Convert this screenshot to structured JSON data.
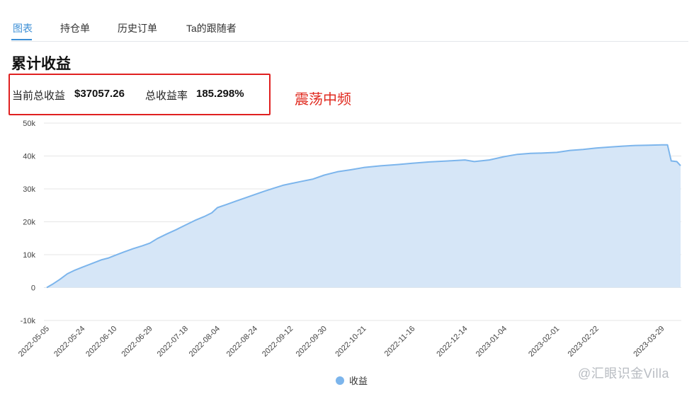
{
  "tabs": [
    {
      "label": "图表",
      "active": true
    },
    {
      "label": "持仓单",
      "active": false
    },
    {
      "label": "历史订单",
      "active": false
    },
    {
      "label": "Ta的跟随者",
      "active": false
    }
  ],
  "section_title": "累计收益",
  "summary": {
    "current_profit_label": "当前总收益",
    "current_profit_value": "$37057.26",
    "return_rate_label": "总收益率",
    "return_rate_value": "185.298%"
  },
  "annotation": "震荡中频",
  "watermark": "@汇眼识金Villa",
  "colors": {
    "accent": "#3c8fd6",
    "series_line": "#7cb5ec",
    "series_fill": "#d6e6f7",
    "annotation": "#e02a1f",
    "highlight_box": "#e02020"
  },
  "chart_data": {
    "type": "area",
    "title": "",
    "xlabel": "",
    "ylabel": "",
    "ylim": [
      -10000,
      50000
    ],
    "yticks": [
      -10000,
      0,
      10000,
      20000,
      30000,
      40000,
      50000
    ],
    "ytick_labels": [
      "-10k",
      "0",
      "10k",
      "20k",
      "30k",
      "40k",
      "50k"
    ],
    "xtick_labels": [
      "2022-05-05",
      "2022-05-24",
      "2022-06-10",
      "2022-06-29",
      "2022-07-18",
      "2022-08-04",
      "2022-08-24",
      "2022-09-12",
      "2022-09-30",
      "2022-10-21",
      "2022-11-16",
      "2022-12-14",
      "2023-01-04",
      "2023-02-01",
      "2023-02-22",
      "2023-03-29"
    ],
    "grid": true,
    "legend_position": "bottom-center",
    "series": [
      {
        "name": "收益",
        "points": [
          [
            "2022-05-05",
            0
          ],
          [
            "2022-05-08",
            1000
          ],
          [
            "2022-05-12",
            2500
          ],
          [
            "2022-05-16",
            4200
          ],
          [
            "2022-05-20",
            5300
          ],
          [
            "2022-05-24",
            6200
          ],
          [
            "2022-05-29",
            7300
          ],
          [
            "2022-06-03",
            8400
          ],
          [
            "2022-06-07",
            9000
          ],
          [
            "2022-06-10",
            9700
          ],
          [
            "2022-06-15",
            10800
          ],
          [
            "2022-06-20",
            11800
          ],
          [
            "2022-06-25",
            12700
          ],
          [
            "2022-06-29",
            13500
          ],
          [
            "2022-07-03",
            14900
          ],
          [
            "2022-07-08",
            16300
          ],
          [
            "2022-07-13",
            17600
          ],
          [
            "2022-07-18",
            19000
          ],
          [
            "2022-07-23",
            20400
          ],
          [
            "2022-07-28",
            21600
          ],
          [
            "2022-08-01",
            22700
          ],
          [
            "2022-08-04",
            24300
          ],
          [
            "2022-08-09",
            25300
          ],
          [
            "2022-08-14",
            26300
          ],
          [
            "2022-08-19",
            27300
          ],
          [
            "2022-08-24",
            28300
          ],
          [
            "2022-08-29",
            29300
          ],
          [
            "2022-09-03",
            30200
          ],
          [
            "2022-09-08",
            31100
          ],
          [
            "2022-09-12",
            31600
          ],
          [
            "2022-09-18",
            32300
          ],
          [
            "2022-09-24",
            33000
          ],
          [
            "2022-09-30",
            34200
          ],
          [
            "2022-10-07",
            35200
          ],
          [
            "2022-10-14",
            35800
          ],
          [
            "2022-10-21",
            36500
          ],
          [
            "2022-10-30",
            37000
          ],
          [
            "2022-11-08",
            37400
          ],
          [
            "2022-11-16",
            37800
          ],
          [
            "2022-11-25",
            38200
          ],
          [
            "2022-12-05",
            38500
          ],
          [
            "2022-12-14",
            38800
          ],
          [
            "2022-12-19",
            38300
          ],
          [
            "2022-12-27",
            38800
          ],
          [
            "2023-01-04",
            39800
          ],
          [
            "2023-01-11",
            40500
          ],
          [
            "2023-01-18",
            40800
          ],
          [
            "2023-01-25",
            40900
          ],
          [
            "2023-02-01",
            41100
          ],
          [
            "2023-02-08",
            41700
          ],
          [
            "2023-02-15",
            42000
          ],
          [
            "2023-02-22",
            42400
          ],
          [
            "2023-03-01",
            42700
          ],
          [
            "2023-03-08",
            43000
          ],
          [
            "2023-03-15",
            43200
          ],
          [
            "2023-03-22",
            43300
          ],
          [
            "2023-03-29",
            43400
          ],
          [
            "2023-04-01",
            43400
          ],
          [
            "2023-04-03",
            38500
          ],
          [
            "2023-04-06",
            38300
          ],
          [
            "2023-04-08",
            37057.26
          ]
        ]
      }
    ]
  }
}
